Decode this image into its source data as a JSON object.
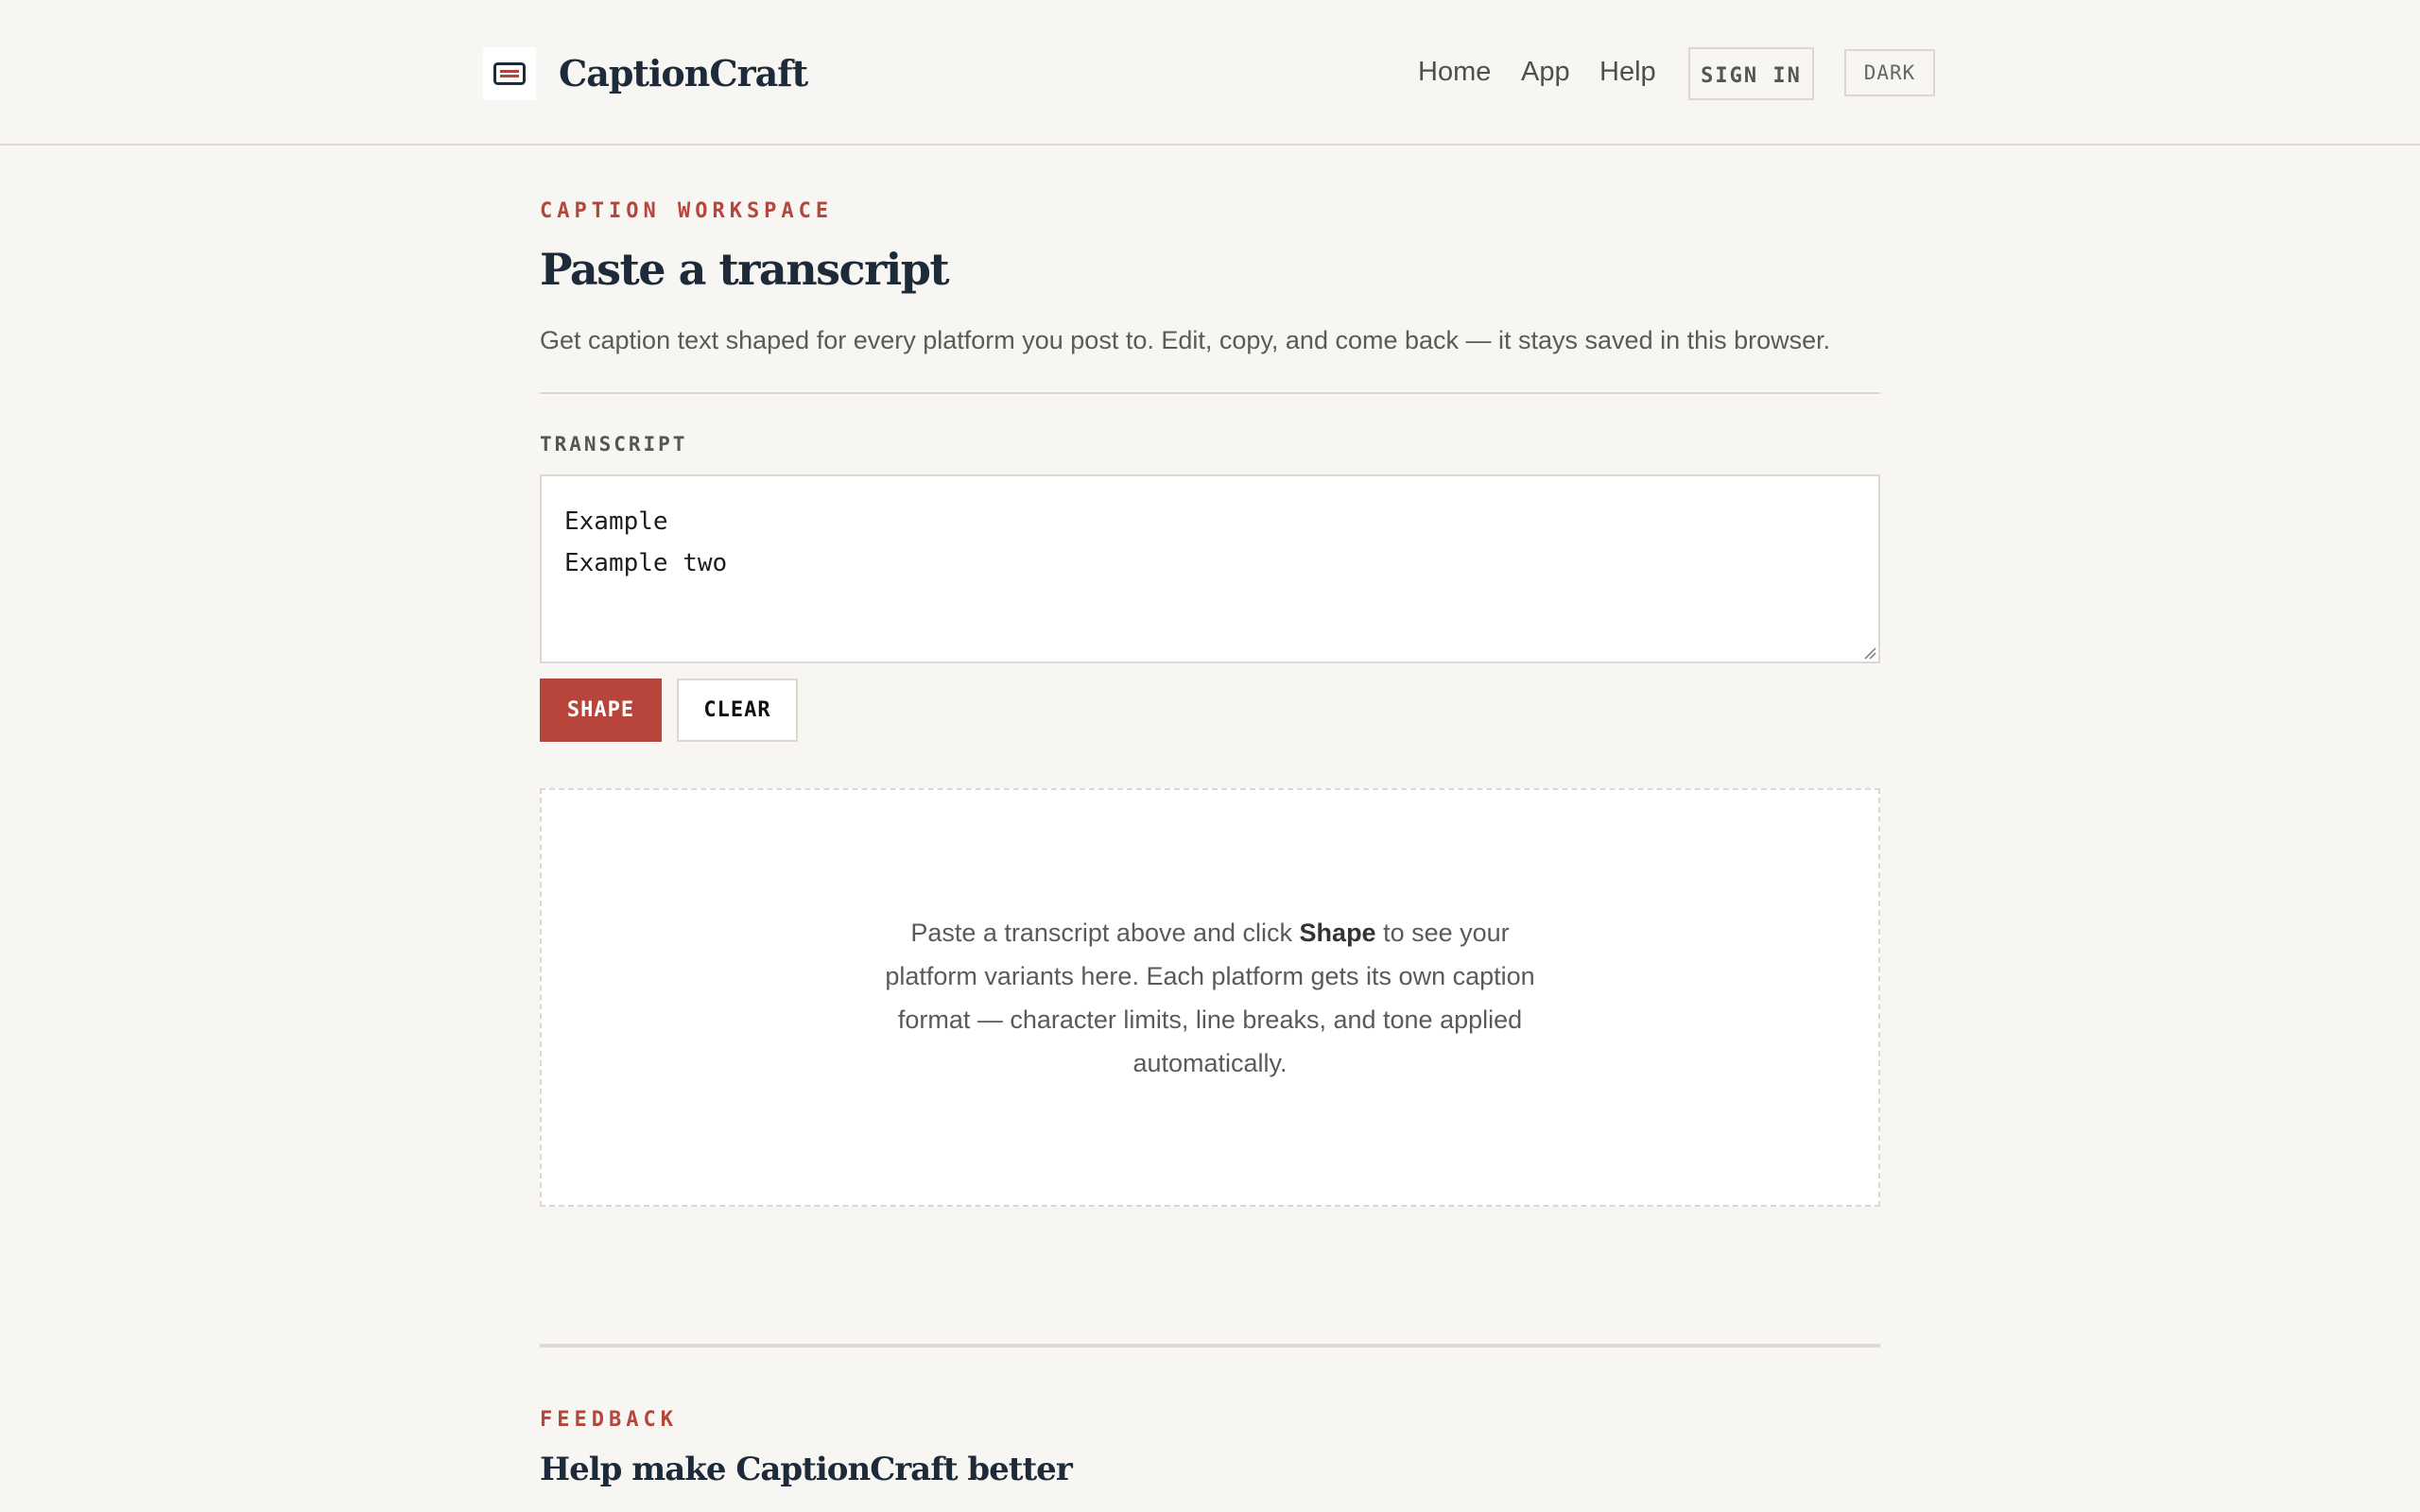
{
  "header": {
    "brand": "CaptionCraft",
    "logo_icon": "caption-card-icon",
    "nav": {
      "home": "Home",
      "app": "App",
      "help": "Help"
    },
    "sign_in_label": "SIGN IN",
    "theme_toggle_label": "DARK"
  },
  "workspace": {
    "eyebrow": "CAPTION WORKSPACE",
    "title": "Paste a transcript",
    "subtitle": "Get caption text shaped for every platform you post to. Edit, copy, and come back — it stays saved in this browser.",
    "transcript_label": "TRANSCRIPT",
    "transcript_value": "Example\nExample two",
    "shape_label": "SHAPE",
    "clear_label": "CLEAR",
    "empty_state": {
      "before": "Paste a transcript above and click ",
      "emphasis": "Shape",
      "after": " to see your platform variants here. Each platform gets its own caption format — character limits, line breaks, and tone applied automatically."
    }
  },
  "feedback": {
    "eyebrow": "FEEDBACK",
    "title": "Help make CaptionCraft better"
  },
  "colors": {
    "accent": "#b7453b",
    "ink": "#1d2a3a",
    "background": "#f8f6f2",
    "border": "#dcd8d0"
  }
}
